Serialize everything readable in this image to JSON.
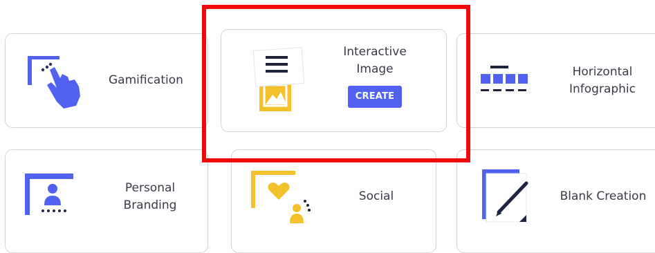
{
  "templates": [
    {
      "id": "gamification",
      "label_lines": [
        "Gamification"
      ],
      "icon": "pointing-hand-icon"
    },
    {
      "id": "interactive-image",
      "label_lines": [
        "Interactive",
        "Image"
      ],
      "icon": "interactive-image-icon",
      "action_label": "CREATE"
    },
    {
      "id": "horizontal-infographic",
      "label_lines": [
        "Horizontal",
        "Infographic"
      ],
      "icon": "horizontal-infographic-icon"
    },
    {
      "id": "personal-branding",
      "label_lines": [
        "Personal",
        "Branding"
      ],
      "icon": "personal-branding-icon"
    },
    {
      "id": "social",
      "label_lines": [
        "Social"
      ],
      "icon": "social-heart-icon"
    },
    {
      "id": "blank-creation",
      "label_lines": [
        "Blank Creation"
      ],
      "icon": "pen-page-icon"
    }
  ],
  "colors": {
    "brand_blue": "#5162f0",
    "accent_yellow": "#f3c12c",
    "highlight_red": "#ee0a0a",
    "card_border": "#d3d3d8",
    "text": "#3a3a48"
  }
}
